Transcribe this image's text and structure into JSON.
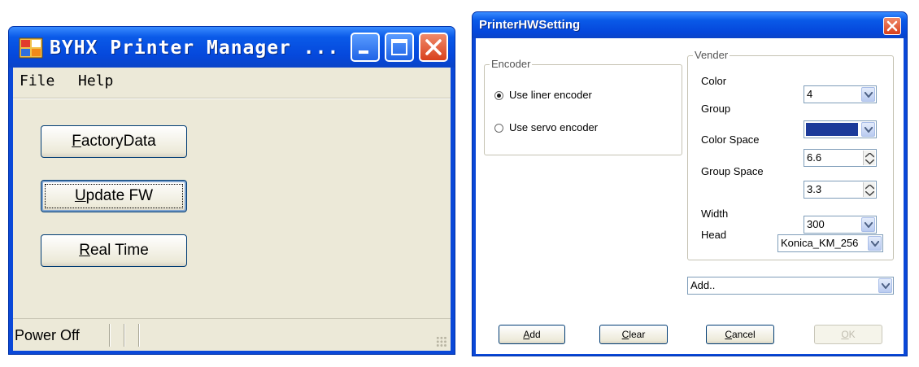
{
  "window1": {
    "title": "BYHX Printer Manager ...",
    "menu": [
      "File",
      "Help"
    ],
    "buttons": {
      "factory_prefix": "F",
      "factory_rest": "actoryData",
      "update_prefix": "U",
      "update_rest": "pdate FW",
      "realtime_prefix": "R",
      "realtime_rest": "eal Time"
    },
    "status": "Power Off",
    "icons": [
      "app-icon",
      "minimize-icon",
      "maximize-icon",
      "close-icon",
      "size-grip-icon"
    ],
    "colors": {
      "titlebar": "#0a5ae8",
      "client": "#ece9d8",
      "close": "#d8401c"
    }
  },
  "window2": {
    "title": "PrinterHWSetting",
    "encoder": {
      "label": "Encoder",
      "options": [
        "Use liner encoder",
        "Use servo encoder"
      ],
      "selected": "Use liner encoder"
    },
    "vender": {
      "label": "Vender",
      "color_label": "Color",
      "color_value": "4",
      "group_label": "Group",
      "color_space_label": "Color Space",
      "color_space_value": "6.6",
      "group_space_label": "Group Space",
      "group_space_value": "3.3",
      "width_label": "Width",
      "width_value": "300",
      "head_label": "Head",
      "head_value": "Konica_KM_256"
    },
    "add_combo_value": "Add..",
    "buttons": {
      "add_prefix": "A",
      "add_rest": "dd",
      "clear_prefix": "C",
      "clear_rest": "lear",
      "cancel_prefix": "C",
      "cancel_rest": "ancel",
      "ok_prefix": "O",
      "ok_rest": "K"
    },
    "icons": [
      "close-icon",
      "chevron-down-icon",
      "spin-up-icon",
      "spin-down-icon"
    ]
  }
}
